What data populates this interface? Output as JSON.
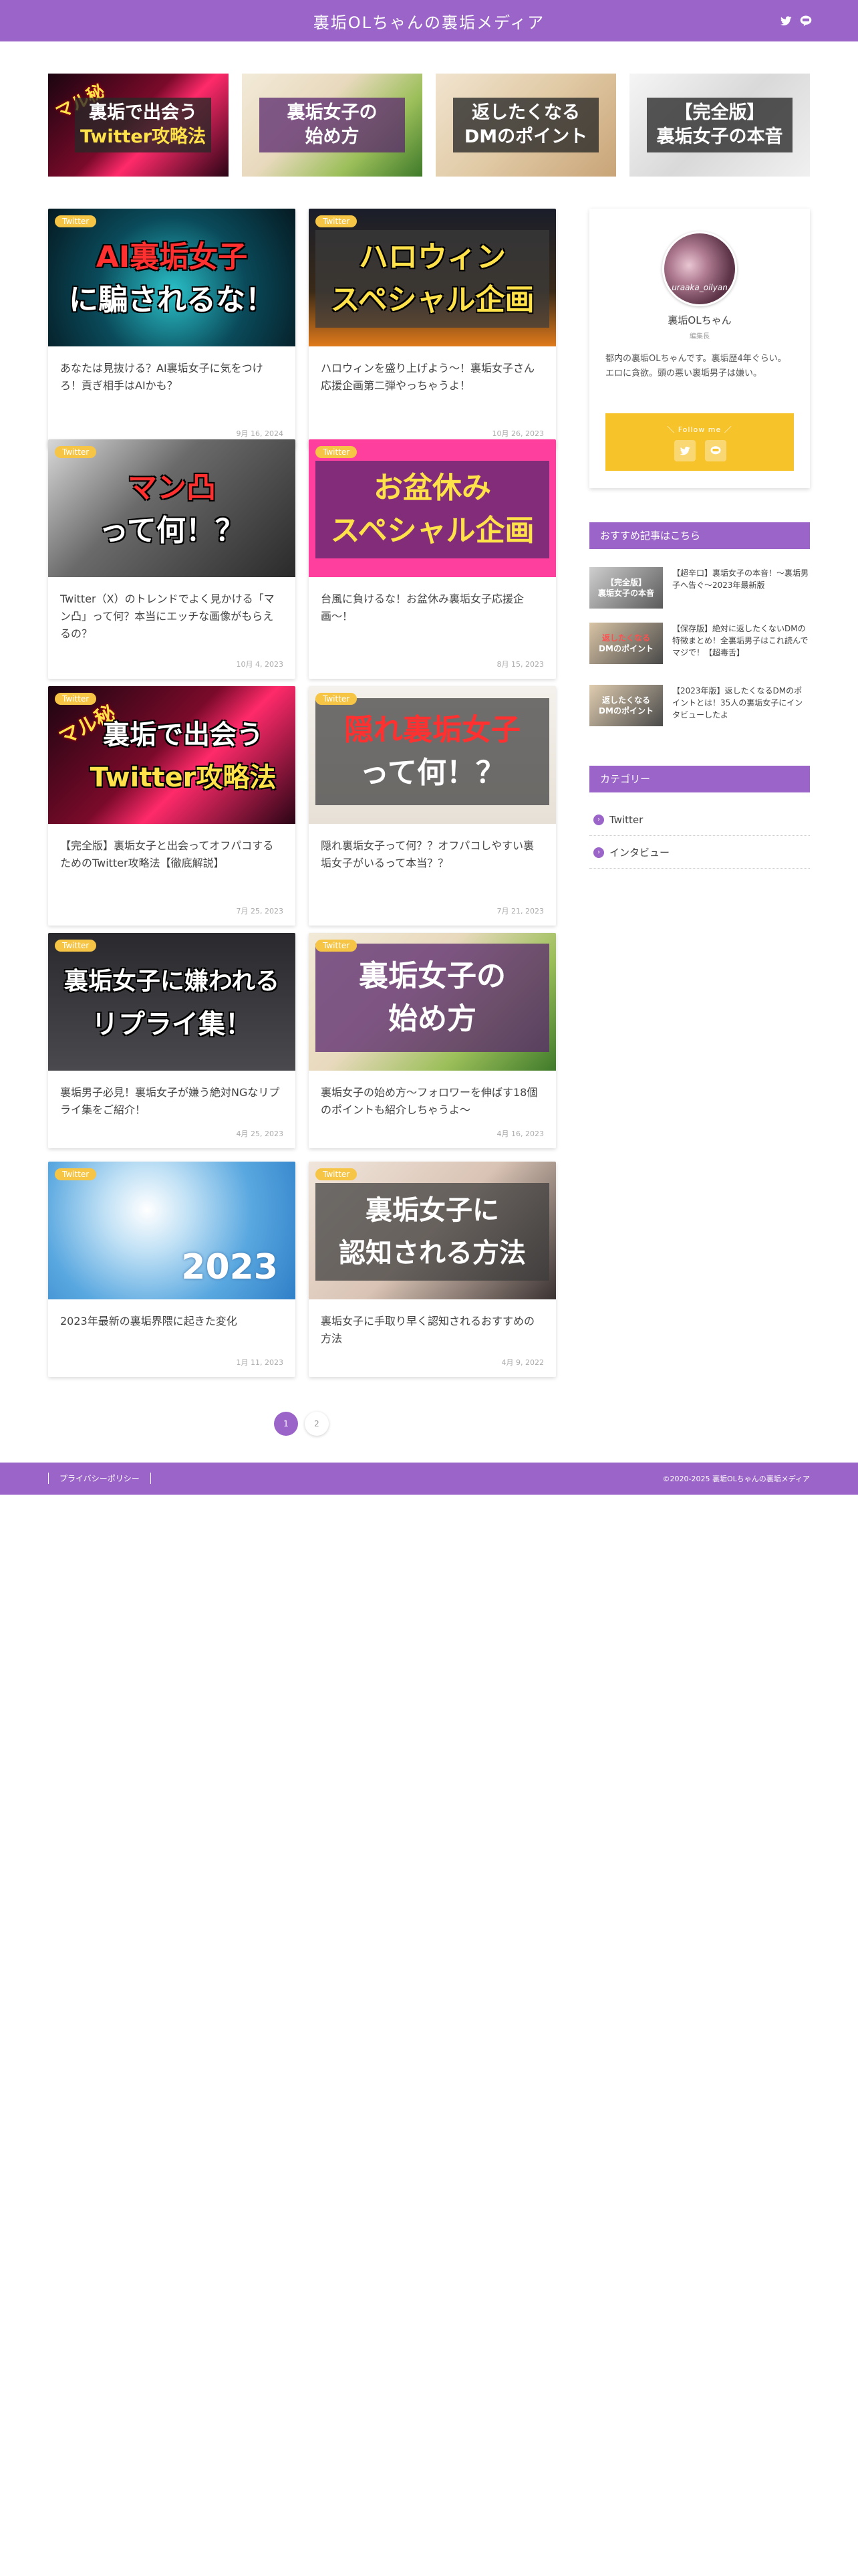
{
  "header": {
    "site_title": "裏垢OLちゃんの裏垢メディア"
  },
  "pickup": [
    {
      "stamp": "マル秘",
      "line1": "裏垢で出会う",
      "line2": "Twitter攻略法"
    },
    {
      "line1": "裏垢女子の",
      "line2": "始め方"
    },
    {
      "line1": "返したくなる",
      "line2": "DMのポイント"
    },
    {
      "line1": "【完全版】",
      "line2": "裏垢女子の本音"
    }
  ],
  "cards": [
    {
      "badge": "Twitter",
      "thumb1": "AI裏垢女子",
      "thumb2": "に騙されるな！",
      "title": "あなたは見抜ける？AI裏垢女子に気をつけろ！貢ぎ相手はAIかも？",
      "date": "9月 16, 2024"
    },
    {
      "badge": "Twitter",
      "thumb1": "ハロウィン",
      "thumb2": "スペシャル企画",
      "title": "ハロウィンを盛り上げよう〜！裏垢女子さん応援企画第二弾やっちゃうよ！",
      "date": "10月 26, 2023"
    },
    {
      "badge": "Twitter",
      "thumb1": "マン凸",
      "thumb2": "って何！？",
      "title": "Twitter（X）のトレンドでよく見かける「マン凸」って何？本当にエッチな画像がもらえるの？",
      "date": "10月 4, 2023"
    },
    {
      "badge": "Twitter",
      "thumb1": "お盆休み",
      "thumb2": "スペシャル企画",
      "title": "台風に負けるな！お盆休み裏垢女子応援企画〜！",
      "date": "8月 15, 2023"
    },
    {
      "badge": "Twitter",
      "thumb0": "マル秘",
      "thumb1": "裏垢で出会う",
      "thumb2": "Twitter攻略法",
      "title": "【完全版】裏垢女子と出会ってオフパコするためのTwitter攻略法【徹底解説】",
      "date": "7月 25, 2023"
    },
    {
      "badge": "Twitter",
      "thumb1": "隠れ裏垢女子",
      "thumb2": "って何！？",
      "title": "隠れ裏垢女子って何？？オフパコしやすい裏垢女子がいるって本当？？",
      "date": "7月 21, 2023"
    },
    {
      "badge": "Twitter",
      "thumb1": "裏垢女子に嫌われる",
      "thumb2": "リプライ集！",
      "title": "裏垢男子必見！裏垢女子が嫌う絶対NGなリプライ集をご紹介！",
      "date": "4月 25, 2023"
    },
    {
      "badge": "Twitter",
      "thumb1": "裏垢女子の",
      "thumb2": "始め方",
      "title": "裏垢女子の始め方〜フォロワーを伸ばす18個のポイントも紹介しちゃうよ〜",
      "date": "4月 16, 2023"
    },
    {
      "badge": "Twitter",
      "thumb1": "2023",
      "title": "2023年最新の裏垢界隈に起きた変化",
      "date": "1月 11, 2023"
    },
    {
      "badge": "Twitter",
      "thumb1": "裏垢女子に",
      "thumb2": "認知される方法",
      "title": "裏垢女子に手取り早く認知されるおすすめの方法",
      "date": "4月 9, 2022"
    }
  ],
  "sidebar": {
    "profile": {
      "avatar_text": "uraaka_oilyan",
      "name": "裏垢OLちゃん",
      "role": "編集長",
      "description": "都内の裏垢OLちゃんです。裏垢歴4年ぐらい。エロに貪欲。頭の悪い裏垢男子は嫌い。",
      "follow_label": "＼ Follow me ／"
    },
    "recommend_title": "おすすめ記事はこちら",
    "recommended": [
      {
        "thumb1": "【完全版】",
        "thumb2": "裏垢女子の本音",
        "text": "【超辛口】裏垢女子の本音！〜裏垢男子へ告ぐ〜2023年最新版"
      },
      {
        "thumb1": "返したくなる",
        "thumb2": "DMのポイント",
        "text": "【保存版】絶対に返したくないDMの特徴まとめ！全裏垢男子はこれ読んでマジで！【超毒舌】"
      },
      {
        "thumb1": "返したくなる",
        "thumb2": "DMのポイント",
        "text": "【2023年版】返したくなるDMのポイントとは！35人の裏垢女子にインタビューしたよ"
      }
    ],
    "category_title": "カテゴリー",
    "categories": [
      "Twitter",
      "インタビュー"
    ]
  },
  "pagination": {
    "current": "1",
    "next": "2"
  },
  "footer": {
    "privacy": "プライバシーポリシー",
    "copyright": "©2020-2025  裏垢OLちゃんの裏垢メディア"
  }
}
